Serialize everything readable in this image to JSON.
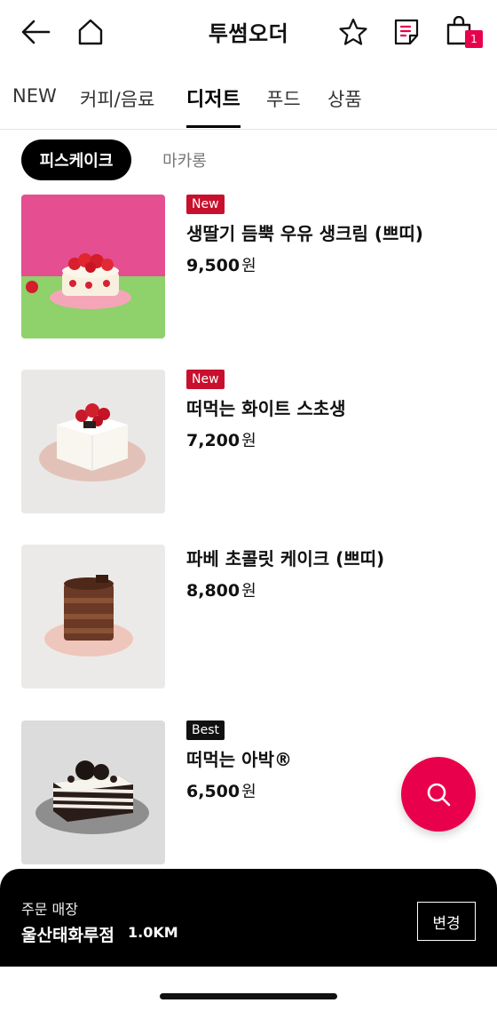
{
  "header": {
    "title": "투썸오더",
    "back_icon": "back-arrow-icon",
    "home_icon": "home-icon",
    "favorite_icon": "star-icon",
    "receipt_icon": "receipt-icon",
    "cart_icon": "shopping-bag-icon",
    "cart_count": "1"
  },
  "tabs": [
    "NEW",
    "커피/음료",
    "디저트",
    "푸드",
    "상품"
  ],
  "active_tab": "디저트",
  "subtabs": {
    "active": "피스케이크",
    "inactive": "마카롱"
  },
  "products": [
    {
      "badge": "New",
      "name": "생딸기 듬뿍 우유 생크림 (쁘띠)",
      "price": "9,500",
      "currency": "원"
    },
    {
      "badge": "New",
      "name": "떠먹는 화이트 스초생",
      "price": "7,200",
      "currency": "원"
    },
    {
      "badge": "",
      "name": "파베 초콜릿 케이크 (쁘띠)",
      "price": "8,800",
      "currency": "원"
    },
    {
      "badge": "Best",
      "name": "떠먹는 아박®",
      "price": "6,500",
      "currency": "원"
    }
  ],
  "search_fab_icon": "search-icon",
  "store": {
    "label": "주문 매장",
    "name": "울산태화루점",
    "distance": "1.0KM",
    "change_label": "변경"
  },
  "colors": {
    "accent": "#e8004c",
    "new_badge": "#c8102e",
    "best_badge": "#111111",
    "store_bar": "#000000"
  }
}
